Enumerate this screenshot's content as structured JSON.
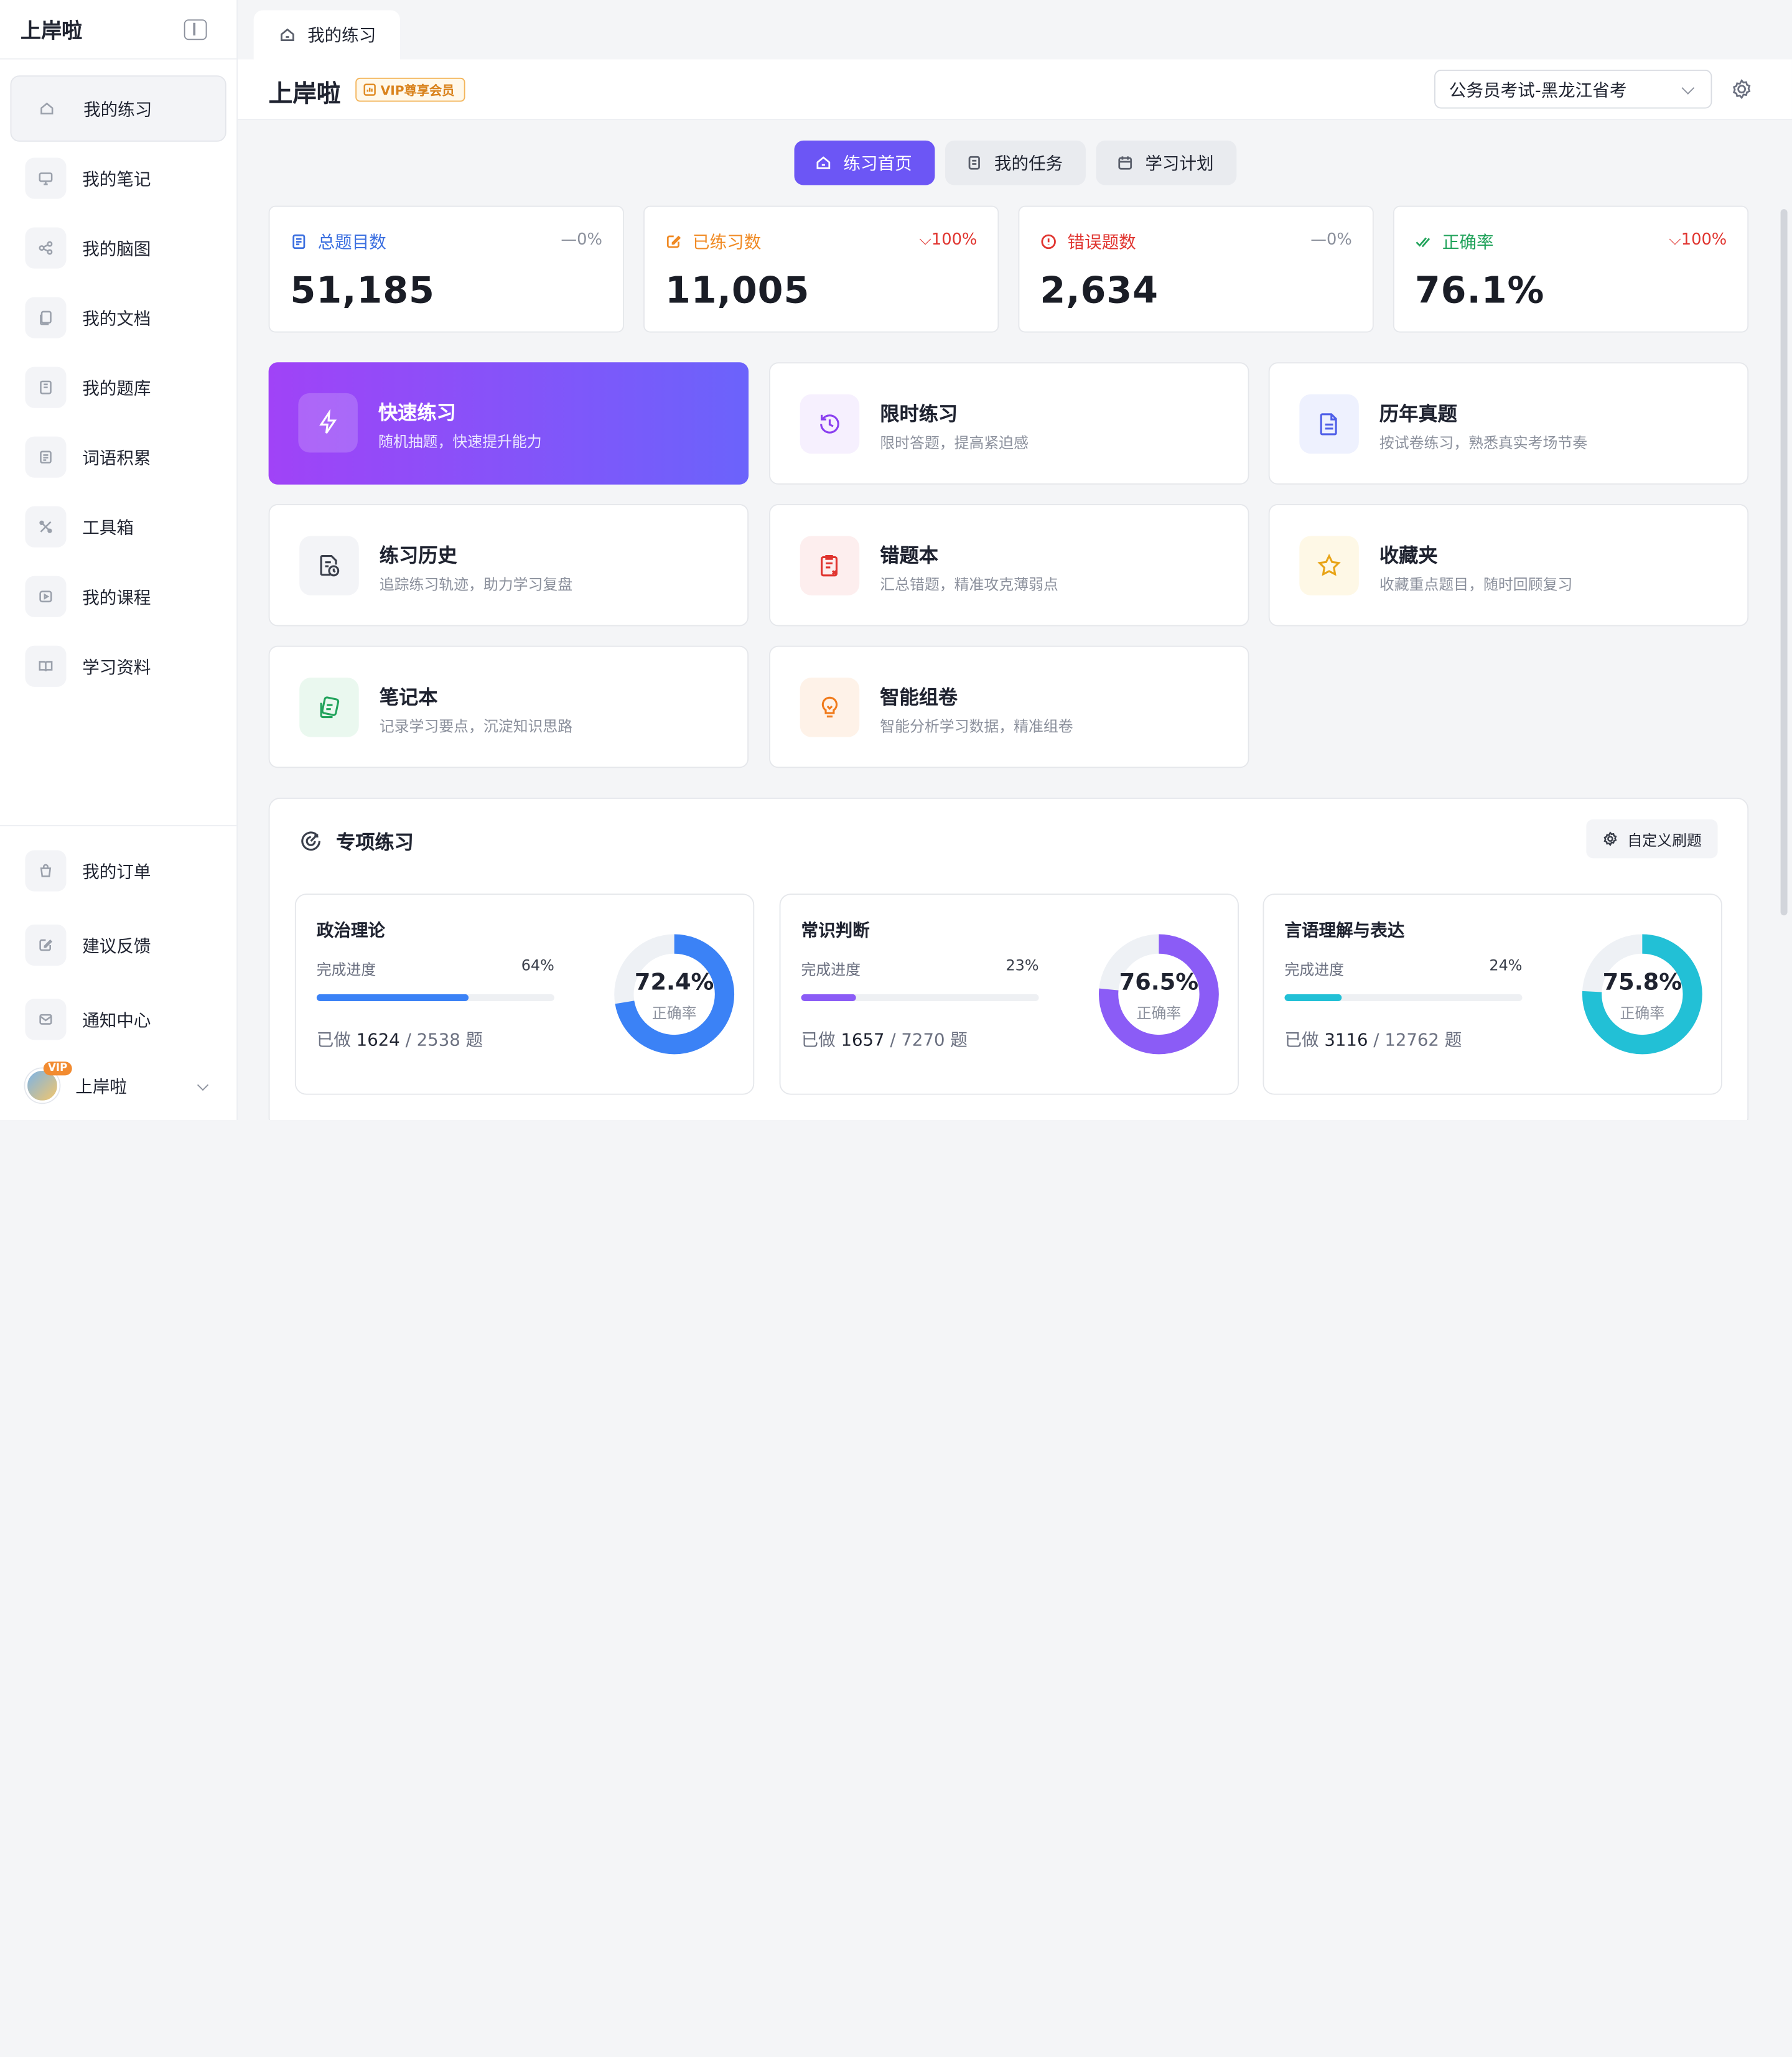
{
  "sidebar": {
    "brand": "上岸啦",
    "items": [
      {
        "label": "我的练习"
      },
      {
        "label": "我的笔记"
      },
      {
        "label": "我的脑图"
      },
      {
        "label": "我的文档"
      },
      {
        "label": "我的题库"
      },
      {
        "label": "词语积累"
      },
      {
        "label": "工具箱"
      },
      {
        "label": "我的课程"
      },
      {
        "label": "学习资料"
      }
    ],
    "bottom_items": [
      {
        "label": "我的订单"
      },
      {
        "label": "建议反馈"
      },
      {
        "label": "通知中心"
      }
    ],
    "user": {
      "name": "上岸啦",
      "badge": "VIP"
    }
  },
  "tabbar": {
    "tab_label": "我的练习"
  },
  "header": {
    "title": "上岸啦",
    "vip_label": "VIP尊享会员",
    "exam_select": "公务员考试-黑龙江省考"
  },
  "segments": [
    {
      "label": "练习首页"
    },
    {
      "label": "我的任务"
    },
    {
      "label": "学习计划"
    }
  ],
  "stats": [
    {
      "label": "总题目数",
      "delta": "—0%",
      "value": "51,185",
      "color": "#3b6fe0"
    },
    {
      "label": "已练习数",
      "delta": "100%",
      "value": "11,005",
      "color": "#f08a24"
    },
    {
      "label": "错误题数",
      "delta": "—0%",
      "value": "2,634",
      "color": "#e0342f"
    },
    {
      "label": "正确率",
      "delta": "100%",
      "value": "76.1%",
      "color": "#21a35b"
    }
  ],
  "cards": [
    {
      "title": "快速练习",
      "desc": "随机抽题，快速提升能力"
    },
    {
      "title": "限时练习",
      "desc": "限时答题，提高紧迫感"
    },
    {
      "title": "历年真题",
      "desc": "按试卷练习，熟悉真实考场节奏"
    },
    {
      "title": "练习历史",
      "desc": "追踪练习轨迹，助力学习复盘"
    },
    {
      "title": "错题本",
      "desc": "汇总错题，精准攻克薄弱点"
    },
    {
      "title": "收藏夹",
      "desc": "收藏重点题目，随时回顾复习"
    },
    {
      "title": "笔记本",
      "desc": "记录学习要点，沉淀知识思路"
    },
    {
      "title": "智能组卷",
      "desc": "智能分析学习数据，精准组卷"
    }
  ],
  "special": {
    "title": "专项练习",
    "custom_button": "自定义刷题",
    "progress_label": "完成进度",
    "done_prefix": "已做",
    "done_suffix": "题",
    "accuracy_label": "正确率",
    "subjects": [
      {
        "name": "政治理论",
        "progress": "64%",
        "progress_value": 0.64,
        "done": "1624",
        "total": "/ 2538",
        "accuracy": "72.4%",
        "accuracy_value": 0.724,
        "color": "#3b82f6"
      },
      {
        "name": "常识判断",
        "progress": "23%",
        "progress_value": 0.23,
        "done": "1657",
        "total": "/ 7270",
        "accuracy": "76.5%",
        "accuracy_value": 0.765,
        "color": "#8b5cf6"
      },
      {
        "name": "言语理解与表达",
        "progress": "24%",
        "progress_value": 0.24,
        "done": "3116",
        "total": "/ 12762",
        "accuracy": "75.8%",
        "accuracy_value": 0.758,
        "color": "#22c0d6"
      }
    ]
  }
}
